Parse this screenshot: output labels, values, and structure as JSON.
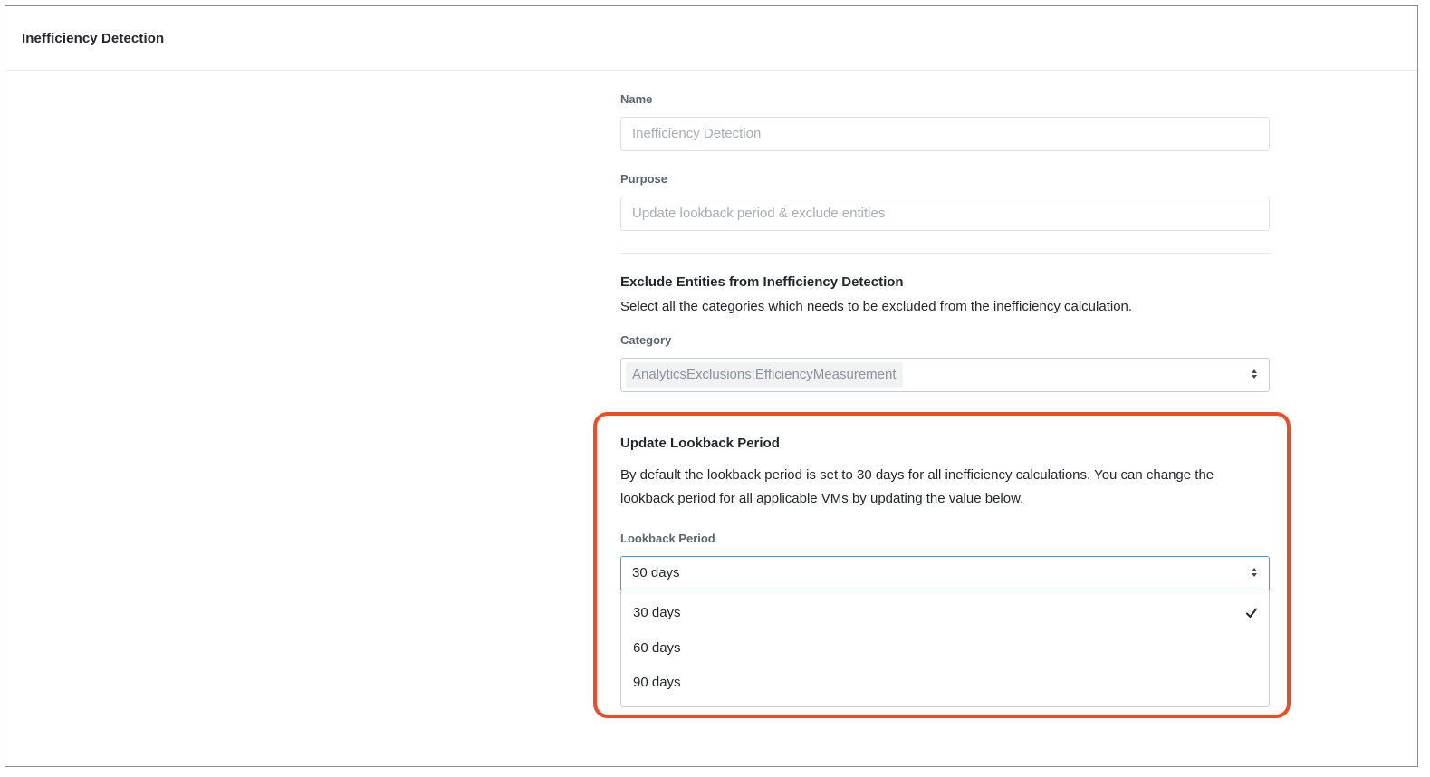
{
  "header": {
    "title": "Inefficiency Detection"
  },
  "form": {
    "name": {
      "label": "Name",
      "placeholder": "Inefficiency Detection"
    },
    "purpose": {
      "label": "Purpose",
      "placeholder": "Update lookback period & exclude entities"
    },
    "exclude": {
      "title": "Exclude Entities from Inefficiency Detection",
      "description": "Select all the categories which needs to be excluded from the inefficiency calculation.",
      "category_label": "Category",
      "selected_tag": "AnalyticsExclusions:EfficiencyMeasurement"
    },
    "lookback": {
      "title": "Update Lookback Period",
      "description": "By default the lookback period is set to 30 days for all inefficiency calculations. You can change the lookback period for all applicable VMs by updating the value below.",
      "field_label": "Lookback Period",
      "selected_value": "30 days",
      "options": [
        {
          "label": "30 days",
          "selected": true
        },
        {
          "label": "60 days",
          "selected": false
        },
        {
          "label": "90 days",
          "selected": false
        }
      ]
    }
  },
  "colors": {
    "highlight": "#f04b23",
    "focus_border": "#2f9ce6"
  },
  "icons": {
    "select_toggle": "updown-chevron-icon",
    "selected_mark": "check-icon"
  }
}
